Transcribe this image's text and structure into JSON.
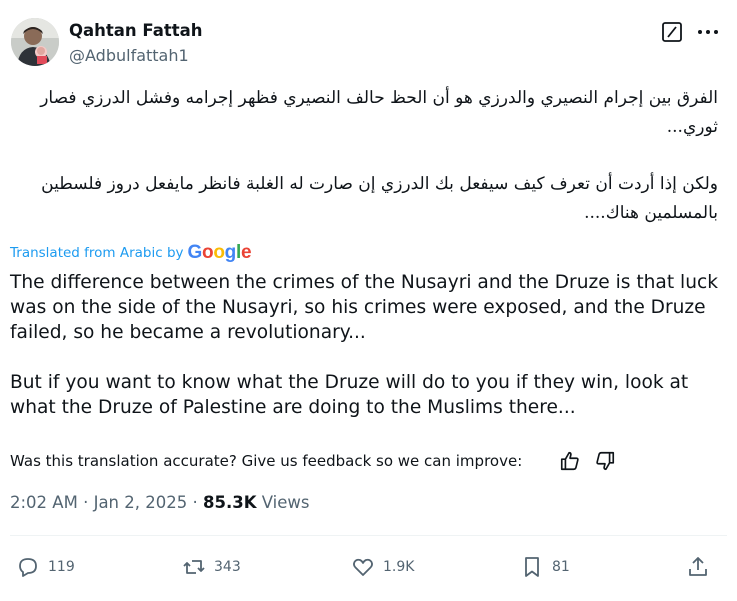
{
  "author": {
    "name": "Qahtan Fattah",
    "handle": "@Adbulfattah1"
  },
  "header": {
    "grok_icon": "grok-icon",
    "more_icon": "more-icon"
  },
  "tweet": {
    "arabic_paragraphs": [
      "الفرق بين إجرام النصيري والدرزي هو أن الحظ حالف النصيري فظهر إجرامه وفشل الدرزي فصار ثوري...",
      "ولكن إذا أردت أن تعرف كيف سيفعل بك الدرزي إن صارت له الغلبة فانظر مايفعل دروز فلسطين بالمسلمين هناك...."
    ],
    "translated_label": "Translated from Arabic by",
    "translated_brand": "Google",
    "translation_paragraphs": [
      "The difference between the crimes of the Nusayri and the Druze is that luck was on the side of the Nusayri, so his crimes were exposed, and the Druze failed, so he became a revolutionary...",
      "But if you want to know what the Druze will do to you if they win, look at what the Druze of Palestine are doing to the Muslims there..."
    ],
    "feedback": "Was this translation accurate? Give us feedback so we can improve:"
  },
  "meta": {
    "time": "2:02 AM",
    "sep": "·",
    "date": "Jan 2, 2025",
    "views_count": "85.3K",
    "views_label": "Views"
  },
  "actions": {
    "replies": "119",
    "reposts": "343",
    "likes": "1.9K",
    "bookmarks": "81"
  },
  "colors": {
    "link": "#1d9bf0",
    "muted": "#536471",
    "text": "#0f1419"
  }
}
